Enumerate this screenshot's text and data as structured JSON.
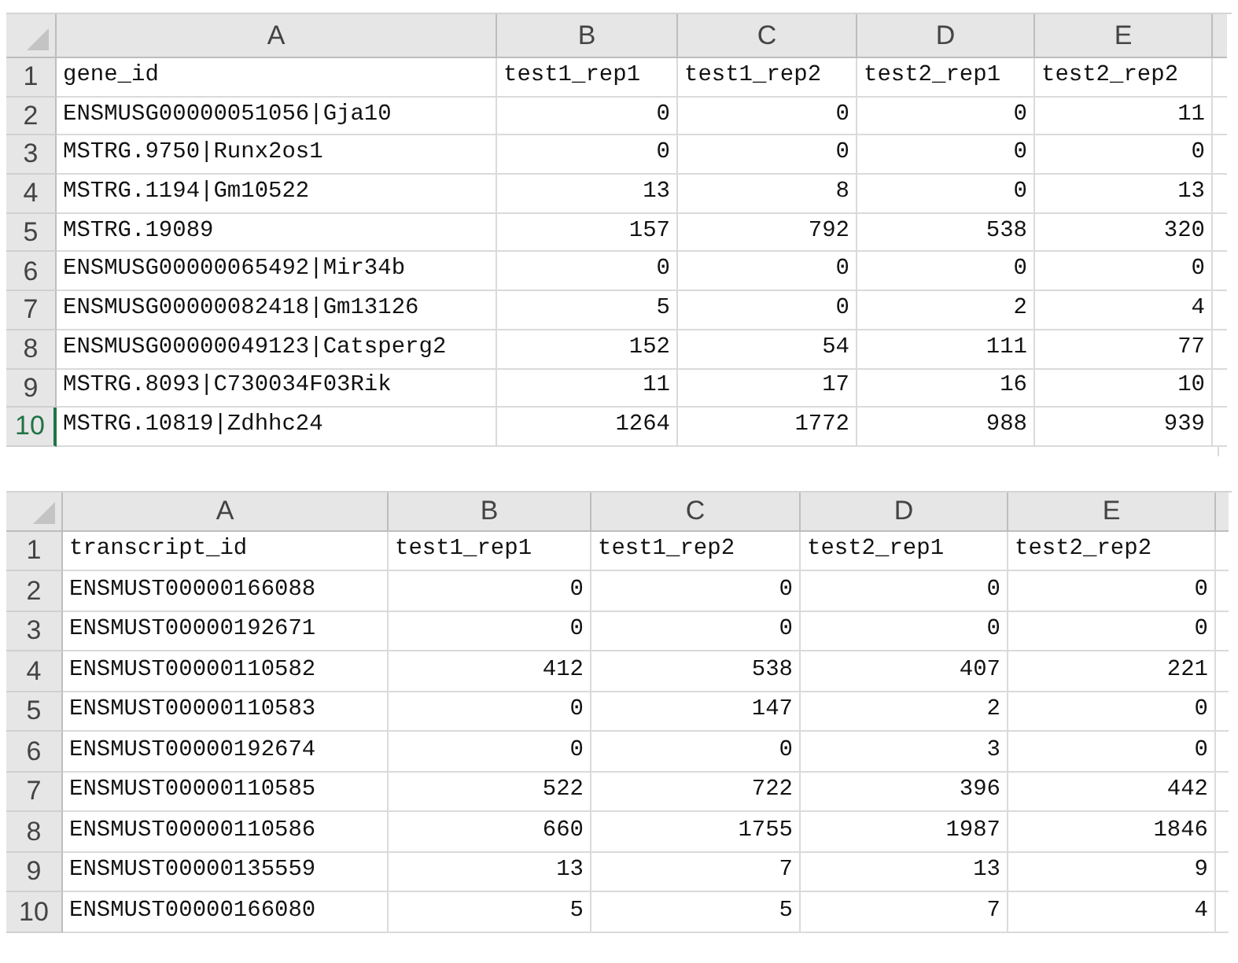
{
  "sheets": [
    {
      "columns": [
        "A",
        "B",
        "C",
        "D",
        "E"
      ],
      "rows": [
        {
          "number": "1",
          "kind": "header",
          "selected": false,
          "cells": [
            "gene_id",
            "test1_rep1",
            "test1_rep2",
            "test2_rep1",
            "test2_rep2"
          ]
        },
        {
          "number": "2",
          "kind": "data",
          "selected": false,
          "cells": [
            "ENSMUSG00000051056|Gja10",
            "0",
            "0",
            "0",
            "11"
          ]
        },
        {
          "number": "3",
          "kind": "data",
          "selected": false,
          "cells": [
            "MSTRG.9750|Runx2os1",
            "0",
            "0",
            "0",
            "0"
          ]
        },
        {
          "number": "4",
          "kind": "data",
          "selected": false,
          "cells": [
            "MSTRG.1194|Gm10522",
            "13",
            "8",
            "0",
            "13"
          ]
        },
        {
          "number": "5",
          "kind": "data",
          "selected": false,
          "cells": [
            "MSTRG.19089",
            "157",
            "792",
            "538",
            "320"
          ]
        },
        {
          "number": "6",
          "kind": "data",
          "selected": false,
          "cells": [
            "ENSMUSG00000065492|Mir34b",
            "0",
            "0",
            "0",
            "0"
          ]
        },
        {
          "number": "7",
          "kind": "data",
          "selected": false,
          "cells": [
            "ENSMUSG00000082418|Gm13126",
            "5",
            "0",
            "2",
            "4"
          ]
        },
        {
          "number": "8",
          "kind": "data",
          "selected": false,
          "cells": [
            "ENSMUSG00000049123|Catsperg2",
            "152",
            "54",
            "111",
            "77"
          ]
        },
        {
          "number": "9",
          "kind": "data",
          "selected": false,
          "cells": [
            "MSTRG.8093|C730034F03Rik",
            "11",
            "17",
            "16",
            "10"
          ]
        },
        {
          "number": "10",
          "kind": "data",
          "selected": true,
          "cells": [
            "MSTRG.10819|Zdhhc24",
            "1264",
            "1772",
            "988",
            "939"
          ]
        }
      ]
    },
    {
      "columns": [
        "A",
        "B",
        "C",
        "D",
        "E"
      ],
      "rows": [
        {
          "number": "1",
          "kind": "header",
          "selected": false,
          "cells": [
            "transcript_id",
            "test1_rep1",
            "test1_rep2",
            "test2_rep1",
            "test2_rep2"
          ]
        },
        {
          "number": "2",
          "kind": "data",
          "selected": false,
          "cells": [
            "ENSMUST00000166088",
            "0",
            "0",
            "0",
            "0"
          ]
        },
        {
          "number": "3",
          "kind": "data",
          "selected": false,
          "cells": [
            "ENSMUST00000192671",
            "0",
            "0",
            "0",
            "0"
          ]
        },
        {
          "number": "4",
          "kind": "data",
          "selected": false,
          "cells": [
            "ENSMUST00000110582",
            "412",
            "538",
            "407",
            "221"
          ]
        },
        {
          "number": "5",
          "kind": "data",
          "selected": false,
          "cells": [
            "ENSMUST00000110583",
            "0",
            "147",
            "2",
            "0"
          ]
        },
        {
          "number": "6",
          "kind": "data",
          "selected": false,
          "cells": [
            "ENSMUST00000192674",
            "0",
            "0",
            "3",
            "0"
          ]
        },
        {
          "number": "7",
          "kind": "data",
          "selected": false,
          "cells": [
            "ENSMUST00000110585",
            "522",
            "722",
            "396",
            "442"
          ]
        },
        {
          "number": "8",
          "kind": "data",
          "selected": false,
          "cells": [
            "ENSMUST00000110586",
            "660",
            "1755",
            "1987",
            "1846"
          ]
        },
        {
          "number": "9",
          "kind": "data",
          "selected": false,
          "cells": [
            "ENSMUST00000135559",
            "13",
            "7",
            "13",
            "9"
          ]
        },
        {
          "number": "10",
          "kind": "data",
          "selected": false,
          "cells": [
            "ENSMUST00000166080",
            "5",
            "5",
            "7",
            "4"
          ]
        }
      ]
    }
  ]
}
